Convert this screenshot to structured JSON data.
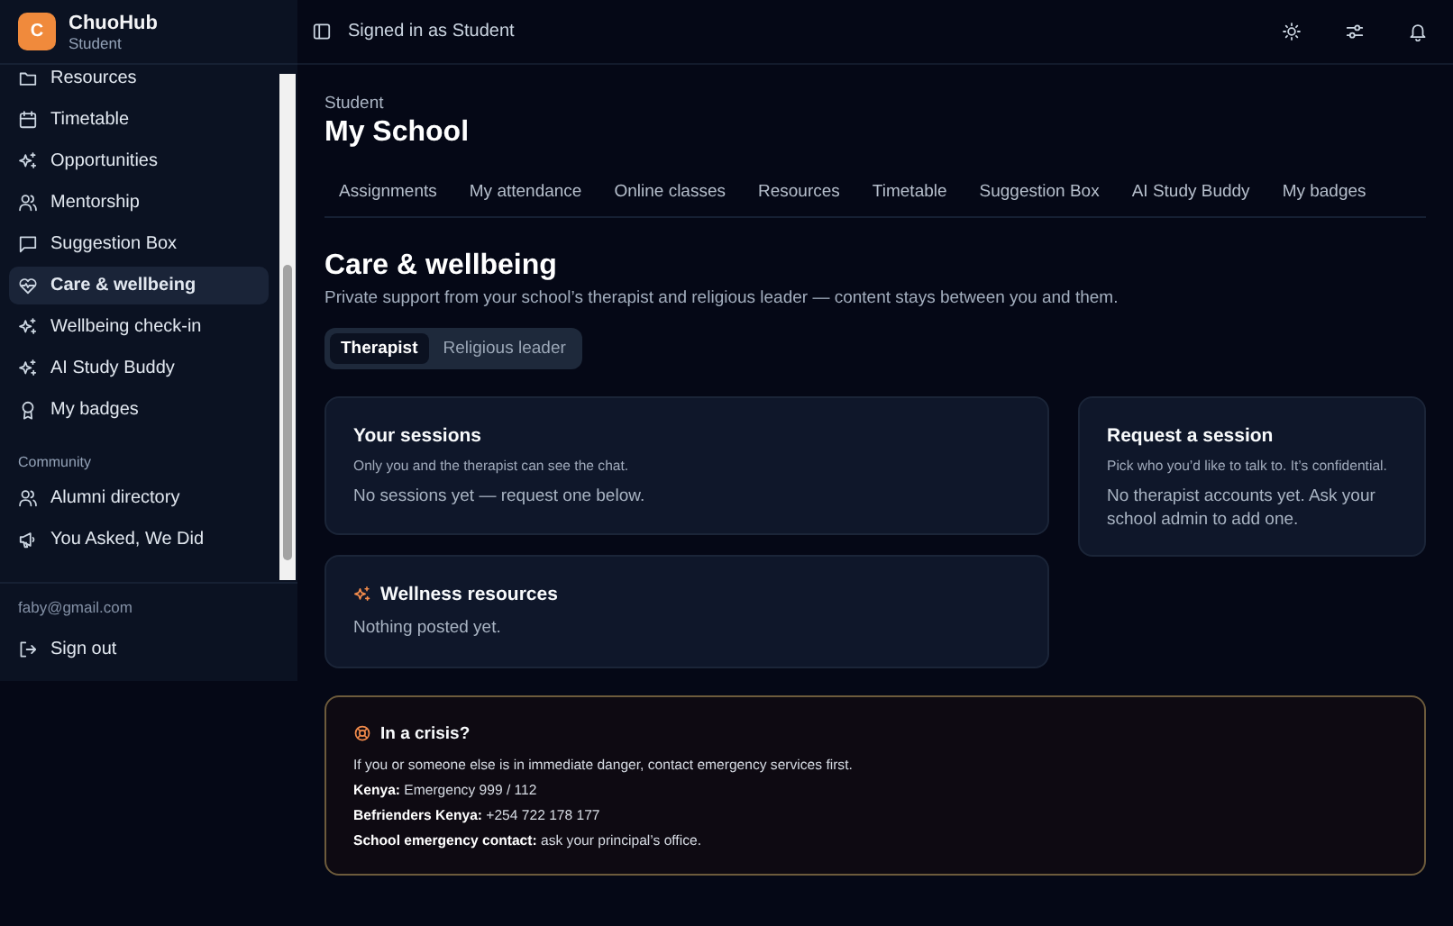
{
  "sidebar": {
    "brand": {
      "initial": "C",
      "name": "ChuoHub",
      "role": "Student"
    },
    "items": [
      {
        "label": "Resources",
        "selected": false
      },
      {
        "label": "Timetable",
        "selected": false
      },
      {
        "label": "Opportunities",
        "selected": false
      },
      {
        "label": "Mentorship",
        "selected": false
      },
      {
        "label": "Suggestion Box",
        "selected": false
      },
      {
        "label": "Care & wellbeing",
        "selected": true
      },
      {
        "label": "Wellbeing check-in",
        "selected": false
      },
      {
        "label": "AI Study Buddy",
        "selected": false
      },
      {
        "label": "My badges",
        "selected": false
      }
    ],
    "community": {
      "heading": "Community",
      "items": [
        {
          "label": "Alumni directory",
          "selected": false
        },
        {
          "label": "You Asked, We Did",
          "selected": false
        }
      ]
    },
    "email": "faby@gmail.com",
    "sign_out": "Sign out"
  },
  "header": {
    "status": "Signed in as Student"
  },
  "page": {
    "eyebrow": "Student",
    "title": "My School",
    "tabs": [
      {
        "label": "Assignments",
        "selected": false
      },
      {
        "label": "My attendance",
        "selected": false
      },
      {
        "label": "Online classes",
        "selected": false
      },
      {
        "label": "Resources",
        "selected": false
      },
      {
        "label": "Timetable",
        "selected": false
      },
      {
        "label": "Suggestion Box",
        "selected": false
      },
      {
        "label": "AI Study Buddy",
        "selected": false
      },
      {
        "label": "My badges",
        "selected": false
      }
    ]
  },
  "section": {
    "title": "Care & wellbeing",
    "subtitle": "Private support from your school’s therapist and religious leader — content stays between you and them.",
    "toggle": [
      {
        "label": "Therapist",
        "selected": true
      },
      {
        "label": "Religious leader",
        "selected": false
      }
    ],
    "sessions": {
      "title": "Your sessions",
      "note": "Only you and the therapist can see the chat.",
      "empty": "No sessions yet — request one below."
    },
    "request": {
      "title": "Request a session",
      "note": "Pick who you’d like to talk to. It’s confidential.",
      "empty": "No therapist accounts yet. Ask your school admin to add one."
    },
    "wellness": {
      "title": "Wellness resources",
      "empty": "Nothing posted yet."
    },
    "crisis": {
      "title": "In a crisis?",
      "lines": [
        "If you or someone else is in immediate danger, contact emergency services first.",
        "**Kenya:** Emergency 999 / 112",
        "**Befrienders Kenya:** +254 722 178 177",
        "**School emergency contact:** ask your principal’s office."
      ]
    }
  }
}
